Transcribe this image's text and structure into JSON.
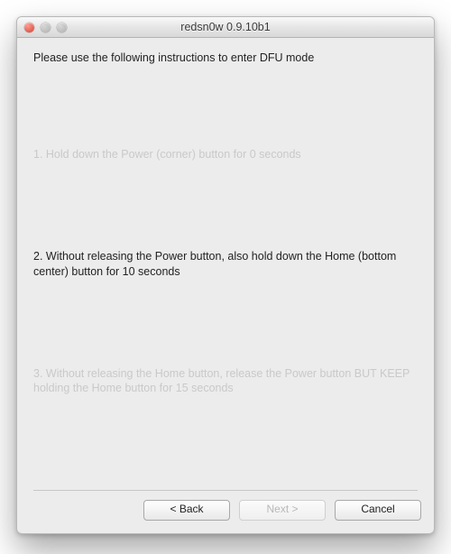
{
  "window": {
    "title": "redsn0w 0.9.10b1"
  },
  "content": {
    "intro": "Please use the following instructions to enter DFU mode",
    "steps": [
      {
        "text": "1. Hold down the Power (corner) button for 0 seconds",
        "active": false
      },
      {
        "text": "2. Without releasing the Power button, also hold down the Home (bottom center) button for 10 seconds",
        "active": true
      },
      {
        "text": "3. Without releasing the Home button, release the Power button BUT KEEP holding the Home button for 15 seconds",
        "active": false
      }
    ]
  },
  "buttons": {
    "back": {
      "label": "< Back",
      "enabled": true
    },
    "next": {
      "label": "Next >",
      "enabled": false
    },
    "cancel": {
      "label": "Cancel",
      "enabled": true
    }
  }
}
